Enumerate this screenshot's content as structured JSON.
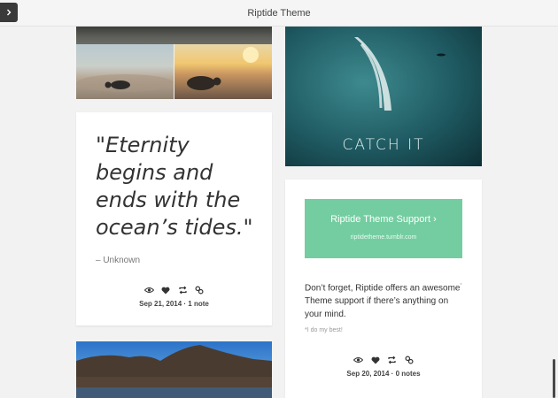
{
  "header": {
    "site_title": "Riptide Theme",
    "menu_icon": "chevron-right-icon"
  },
  "posts": {
    "wave_photo": {
      "caption": "CATCH IT"
    },
    "quote": {
      "text": "\"Eternity begins and ends with the ocean’s tides.\"",
      "source": "– Unknown",
      "date_notes": "Sep 21, 2014 · 1 note",
      "tools": [
        "eye-icon",
        "heart-icon",
        "reblog-icon",
        "link-icon"
      ]
    },
    "support": {
      "link_title": "Riptide Theme Support ›",
      "link_url": "riptidetheme.tumblr.com",
      "body_before": "Don’t forget, Riptide offers an awesome",
      "body_mark": "*",
      "body_after": " Theme support if there’s anything on your mind.",
      "footnote": "*I do my best!",
      "date_notes": "Sep 20, 2014 · 0 notes",
      "tools": [
        "eye-icon",
        "heart-icon",
        "reblog-icon",
        "link-icon"
      ]
    }
  },
  "colors": {
    "support_accent": "#74cda0",
    "page_background": "#f2f2f2",
    "menu_button": "#3a3a3a"
  }
}
